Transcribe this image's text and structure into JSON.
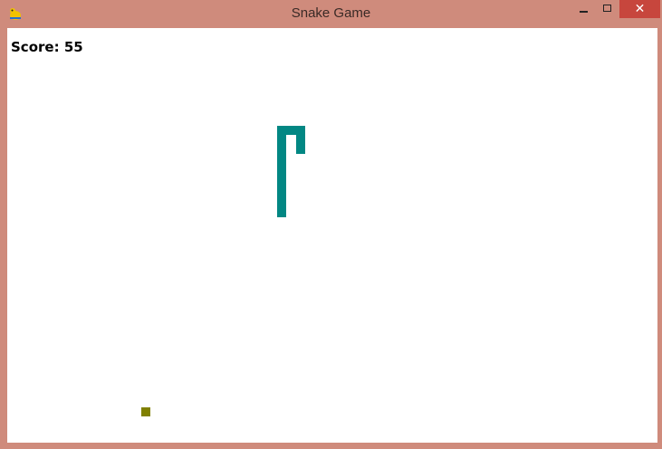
{
  "window": {
    "title": "Snake Game",
    "app_icon": "pygame-snake-icon",
    "controls": [
      "minimize-icon",
      "maximize-icon",
      "close-icon"
    ],
    "close_glyph": "✕"
  },
  "game": {
    "score_label": "Score:",
    "score_value": "55",
    "snake_color": "#028783",
    "food_color": "#808000",
    "background_color": "#ffffff"
  }
}
